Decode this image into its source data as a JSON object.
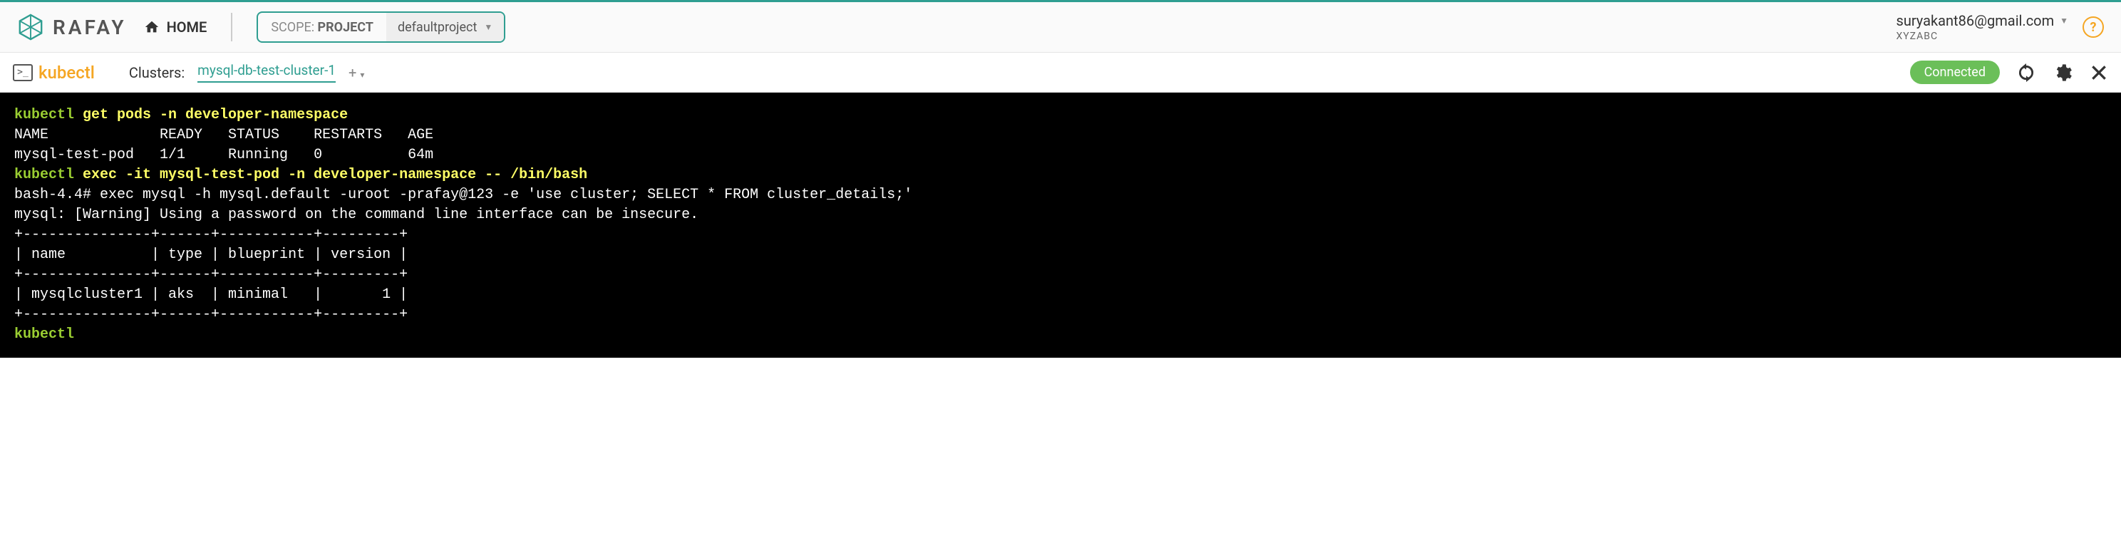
{
  "header": {
    "brand": "RAFAY",
    "home_label": "HOME",
    "scope_prefix": "SCOPE:",
    "scope_target": "PROJECT",
    "scope_value": "defaultproject",
    "user_email": "suryakant86@gmail.com",
    "user_org": "XYZABC"
  },
  "subbar": {
    "kubectl_label": "kubectl",
    "clusters_label": "Clusters:",
    "cluster_name": "mysql-db-test-cluster-1",
    "add_symbol": "+",
    "connected_label": "Connected"
  },
  "terminal": {
    "line1_prompt": "kubectl",
    "line1_rest": " get pods -n developer-namespace",
    "header_row": "NAME             READY   STATUS    RESTARTS   AGE",
    "pod_row": "mysql-test-pod   1/1     Running   0          64m",
    "line4_prompt": "kubectl",
    "line4_rest": " exec -it mysql-test-pod -n developer-namespace -- /bin/bash",
    "bash_line": "bash-4.4# exec mysql -h mysql.default -uroot -prafay@123 -e 'use cluster; SELECT * FROM cluster_details;'",
    "warn_line": "mysql: [Warning] Using a password on the command line interface can be insecure.",
    "tbl_sep": "+---------------+------+-----------+---------+",
    "tbl_head": "| name          | type | blueprint | version |",
    "tbl_row": "| mysqlcluster1 | aks  | minimal   |       1 |",
    "final_prompt": "kubectl"
  },
  "table_data": {
    "pods": [
      {
        "name": "mysql-test-pod",
        "ready": "1/1",
        "status": "Running",
        "restarts": 0,
        "age": "64m"
      }
    ],
    "cluster_details": [
      {
        "name": "mysqlcluster1",
        "type": "aks",
        "blueprint": "minimal",
        "version": 1
      }
    ]
  }
}
